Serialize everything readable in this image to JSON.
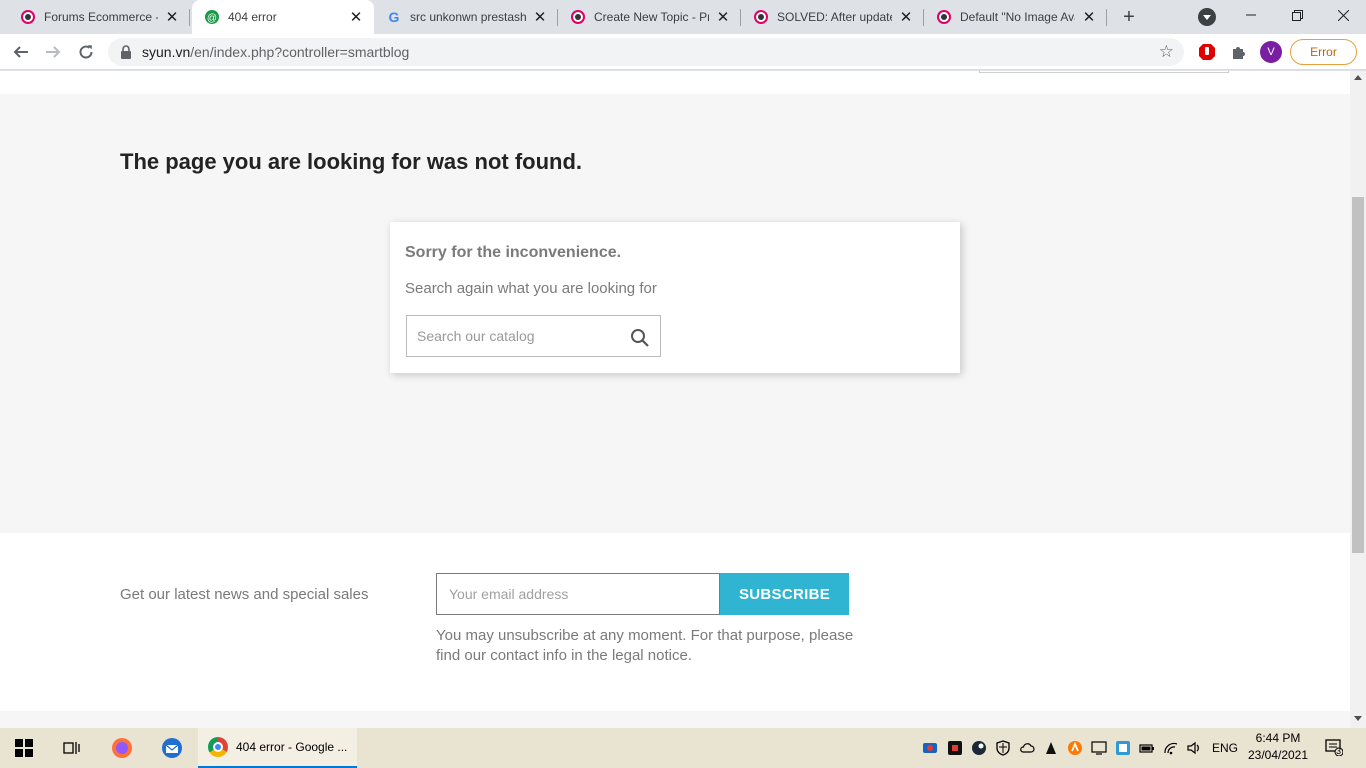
{
  "browser": {
    "tabs": [
      {
        "label": "Forums Ecommerce - P",
        "active": false
      },
      {
        "label": "404 error",
        "active": true
      },
      {
        "label": "src unkonwn prestasho",
        "active": false
      },
      {
        "label": "Create New Topic - Pre",
        "active": false
      },
      {
        "label": "SOLVED: After update",
        "active": false
      },
      {
        "label": "Default \"No Image Ava",
        "active": false
      }
    ],
    "url_host": "syun.vn",
    "url_path": "/en/index.php?controller=smartblog",
    "profile_initial": "V",
    "error_label": "Error"
  },
  "page": {
    "not_found_title": "The page you are looking for was not found.",
    "card_heading": "Sorry for the inconvenience.",
    "card_text": "Search again what you are looking for",
    "search_placeholder": "Search our catalog",
    "newsletter_label": "Get our latest news and special sales",
    "email_placeholder": "Your email address",
    "subscribe_label": "SUBSCRIBE",
    "unsubscribe_note": "You may unsubscribe at any moment. For that purpose, please find our contact info in the legal notice.",
    "accent_color": "#2fb5d2"
  },
  "taskbar": {
    "active_app": "404 error - Google ...",
    "language": "ENG",
    "time": "6:44 PM",
    "date": "23/04/2021",
    "notification_count": "3"
  }
}
